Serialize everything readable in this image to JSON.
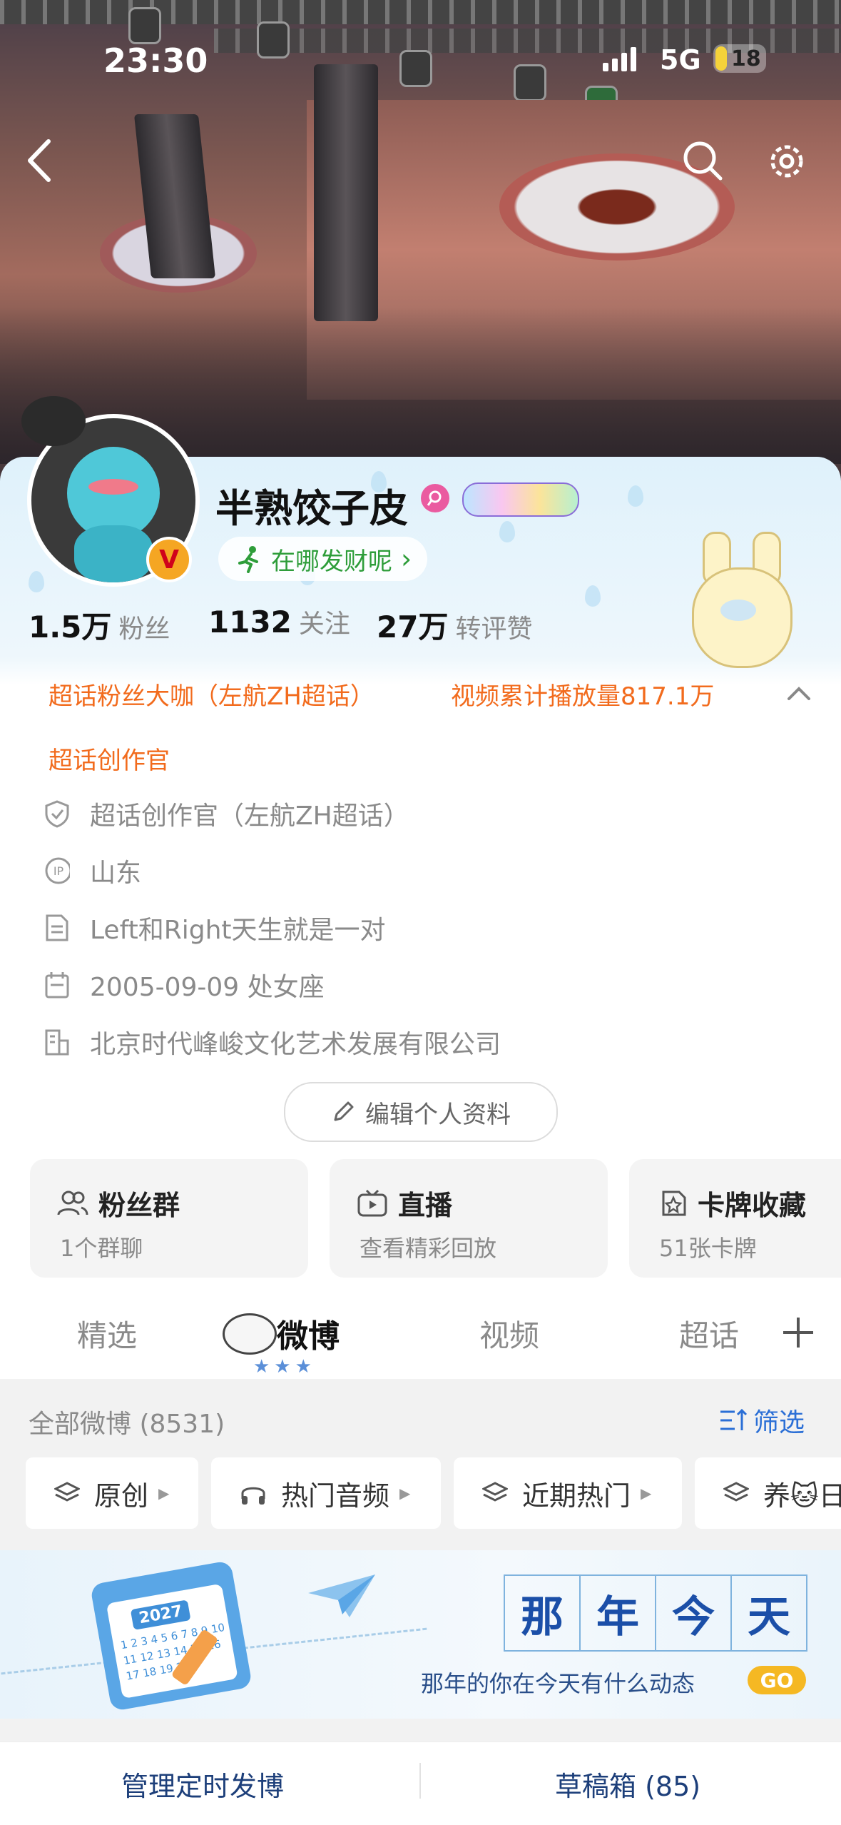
{
  "status_bar": {
    "time": "23:30",
    "network": "5G",
    "battery": "18"
  },
  "nav": {
    "back_icon": "back-chevron-icon",
    "search_icon": "search-icon",
    "settings_icon": "gear-icon"
  },
  "profile": {
    "name": "半熟饺子皮",
    "status": "在哪发财呢",
    "status_arrow": "›",
    "verified_badge": "V",
    "stats": [
      {
        "value": "1.5万",
        "label": "粉丝"
      },
      {
        "value": "1132",
        "label": "关注"
      },
      {
        "value": "27万",
        "label": "转评赞"
      }
    ],
    "honors": [
      "超话粉丝大咖（左航ZH超话）",
      "视频累计播放量817.1万",
      "超话创作官"
    ],
    "details": [
      {
        "icon": "shield-icon",
        "text": "超话创作官（左航ZH超话）"
      },
      {
        "icon": "ip-icon",
        "text": "山东"
      },
      {
        "icon": "document-icon",
        "text": "Left和Right天生就是一对"
      },
      {
        "icon": "calendar-icon",
        "text": "2005-09-09 处女座"
      },
      {
        "icon": "building-icon",
        "text": "北京时代峰峻文化艺术发展有限公司"
      }
    ],
    "edit_button": "编辑个人资料"
  },
  "tiles": [
    {
      "title": "粉丝群",
      "subtitle": "1个群聊",
      "icon": "people-icon"
    },
    {
      "title": "直播",
      "subtitle": "查看精彩回放",
      "icon": "tv-icon"
    },
    {
      "title": "卡牌收藏",
      "subtitle": "51张卡牌",
      "icon": "card-star-icon"
    }
  ],
  "tabs": [
    "精选",
    "微博",
    "视频",
    "超话"
  ],
  "active_tab": "微博",
  "feed": {
    "header": "全部微博 (8531)",
    "filter": "筛选",
    "chips": [
      "原创",
      "热门音频",
      "近期热门",
      "养🐱日"
    ]
  },
  "memory": {
    "chars": [
      "那",
      "年",
      "今",
      "天"
    ],
    "subtitle": "那年的你在今天有什么动态",
    "go": "GO",
    "calendar_year": "2027",
    "calendar_digits": "1 2 3 4 5 6 7 8 9 10 11 12 13 14 15 16 17 18 19 20"
  },
  "bottom_bar": {
    "left": "管理定时发博",
    "right": "草稿箱 (85)"
  },
  "colors": {
    "accent_orange": "#f26b1d",
    "link_blue": "#2b6fd6",
    "verified": "#f5a623"
  }
}
